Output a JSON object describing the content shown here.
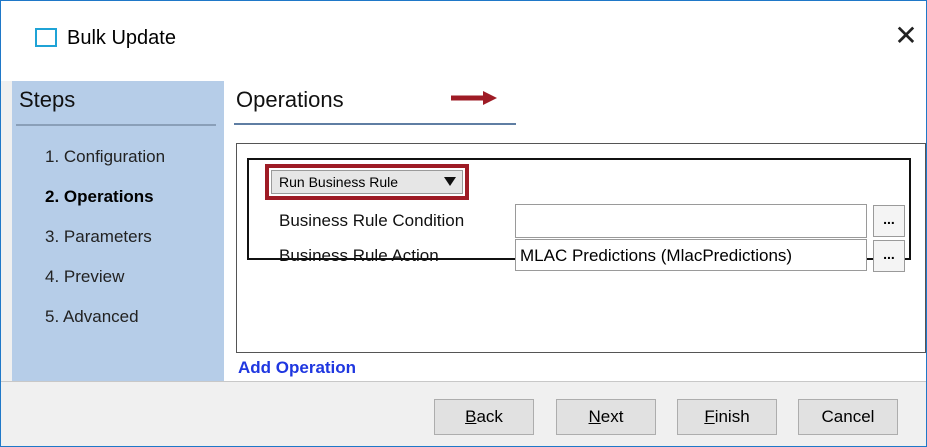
{
  "window": {
    "title": "Bulk Update",
    "close_glyph": "✕",
    "accent_color": "#1f78c8"
  },
  "steps": {
    "heading": "Steps",
    "panel_color": "#b6cde8",
    "items": [
      {
        "label": "1. Configuration",
        "active": false
      },
      {
        "label": "2. Operations",
        "active": true
      },
      {
        "label": "3. Parameters",
        "active": false
      },
      {
        "label": "4. Preview",
        "active": false
      },
      {
        "label": "5. Advanced",
        "active": false
      }
    ]
  },
  "main": {
    "heading": "Operations",
    "operation": {
      "type_selected": "Run Business Rule",
      "highlight_color": "#9e1b25",
      "fields": [
        {
          "label": "Business Rule Condition",
          "value": ""
        },
        {
          "label": "Business Rule Action",
          "value": "MLAC Predictions (MlacPredictions)"
        }
      ],
      "browse_label": "...",
      "controls": {
        "remove": "☒",
        "move_up": "↑",
        "move_down": "↓"
      }
    },
    "add_operation_label": "Add Operation",
    "link_color": "#1f37e0"
  },
  "footer": {
    "buttons": [
      {
        "label_prefix": "",
        "underline": "B",
        "label_rest": "ack"
      },
      {
        "label_prefix": "",
        "underline": "N",
        "label_rest": "ext"
      },
      {
        "label_prefix": "",
        "underline": "F",
        "label_rest": "inish"
      },
      {
        "label_prefix": "Cancel",
        "underline": "",
        "label_rest": ""
      }
    ]
  }
}
